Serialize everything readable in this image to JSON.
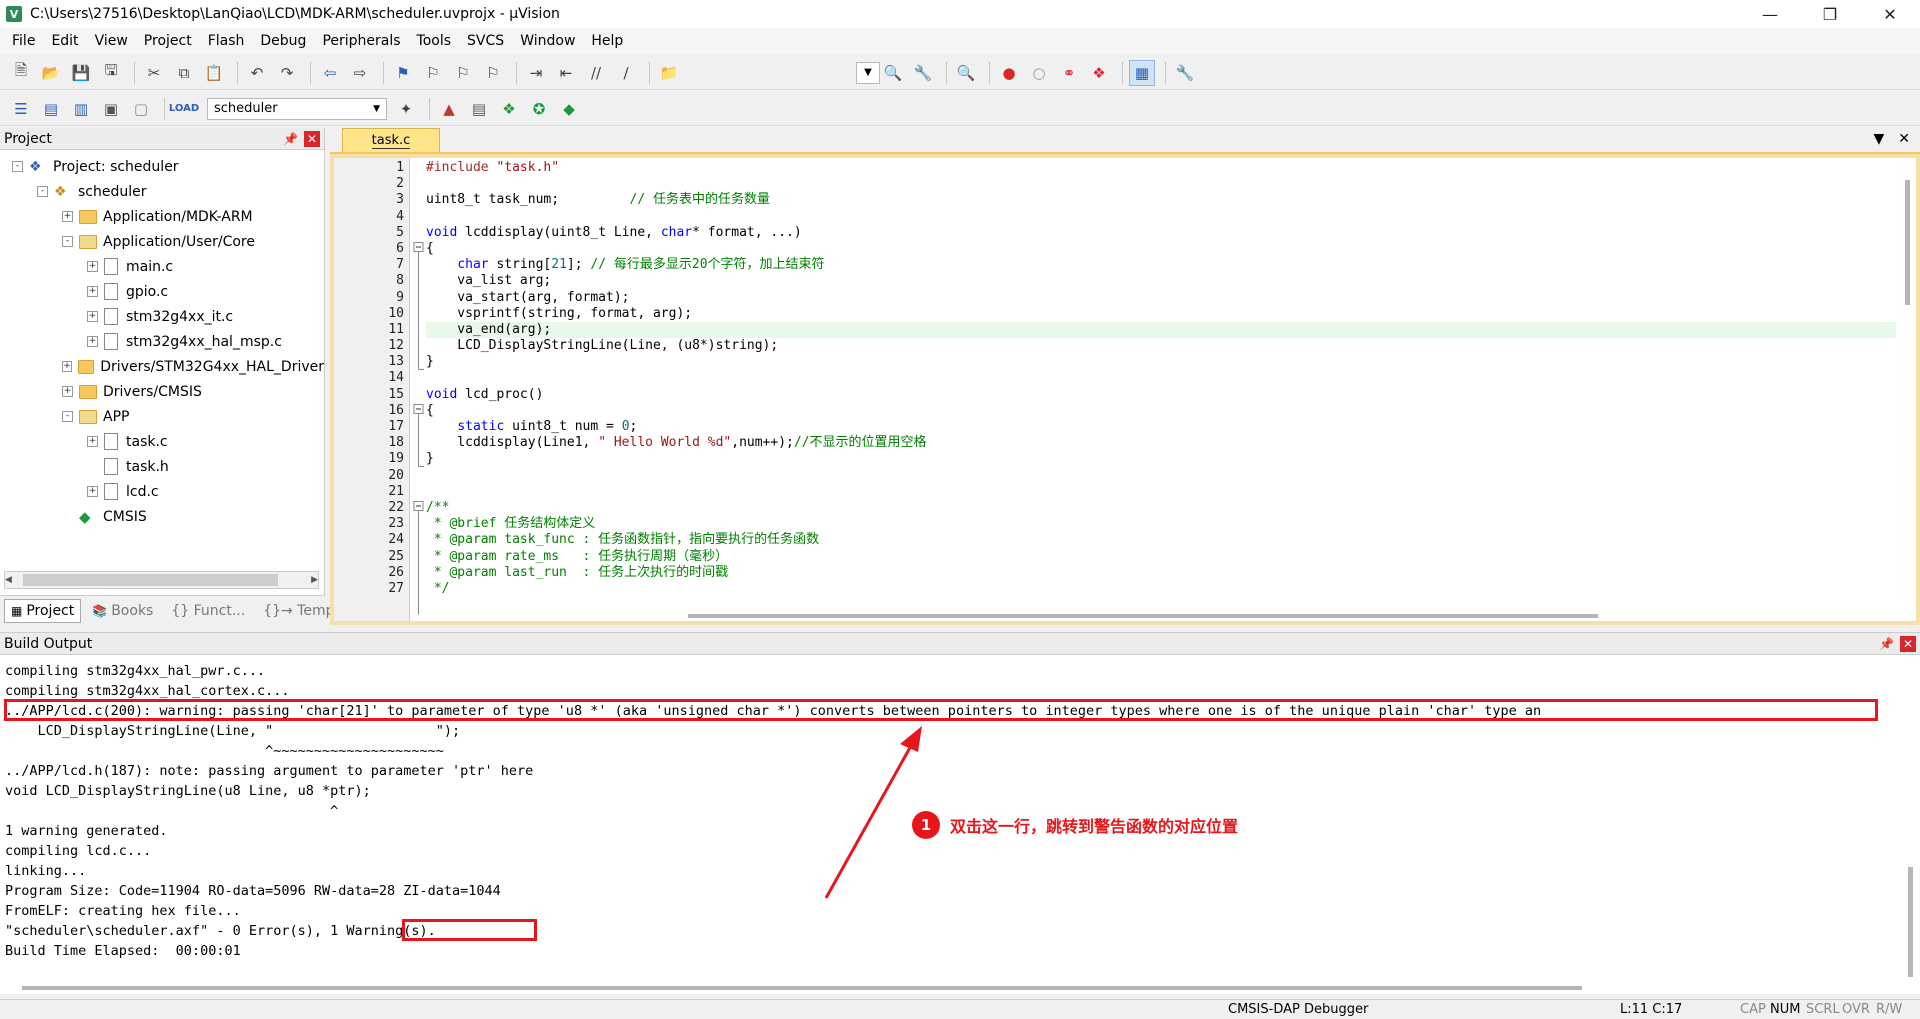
{
  "window": {
    "title": "C:\\Users\\27516\\Desktop\\LanQiao\\LCD\\MDK-ARM\\scheduler.uvprojx - µVision",
    "app_icon_letter": "V"
  },
  "menu": [
    "File",
    "Edit",
    "View",
    "Project",
    "Flash",
    "Debug",
    "Peripherals",
    "Tools",
    "SVCS",
    "Window",
    "Help"
  ],
  "toolbar": {
    "target_name": "scheduler"
  },
  "project_pane": {
    "title": "Project",
    "tree": [
      {
        "label": "Project: scheduler",
        "depth": 0,
        "exp": "-",
        "icon": "project-icon"
      },
      {
        "label": "scheduler",
        "depth": 1,
        "exp": "-",
        "icon": "target-group-icon"
      },
      {
        "label": "Application/MDK-ARM",
        "depth": 2,
        "exp": "+",
        "icon": "folder-icon"
      },
      {
        "label": "Application/User/Core",
        "depth": 2,
        "exp": "-",
        "icon": "folder-open-icon"
      },
      {
        "label": "main.c",
        "depth": 3,
        "exp": "+",
        "icon": "file-icon"
      },
      {
        "label": "gpio.c",
        "depth": 3,
        "exp": "+",
        "icon": "file-icon"
      },
      {
        "label": "stm32g4xx_it.c",
        "depth": 3,
        "exp": "+",
        "icon": "file-icon"
      },
      {
        "label": "stm32g4xx_hal_msp.c",
        "depth": 3,
        "exp": "+",
        "icon": "file-icon"
      },
      {
        "label": "Drivers/STM32G4xx_HAL_Driver",
        "depth": 2,
        "exp": "+",
        "icon": "folder-icon"
      },
      {
        "label": "Drivers/CMSIS",
        "depth": 2,
        "exp": "+",
        "icon": "folder-icon"
      },
      {
        "label": "APP",
        "depth": 2,
        "exp": "-",
        "icon": "folder-open-icon"
      },
      {
        "label": "task.c",
        "depth": 3,
        "exp": "+",
        "icon": "file-icon"
      },
      {
        "label": "task.h",
        "depth": 3,
        "exp": "",
        "icon": "file-icon"
      },
      {
        "label": "lcd.c",
        "depth": 3,
        "exp": "+",
        "icon": "file-icon"
      },
      {
        "label": "CMSIS",
        "depth": 2,
        "exp": "",
        "icon": "cmsis-icon"
      }
    ],
    "tabs": [
      "Project",
      "Books",
      "{} Funct...",
      "{}→ Templ..."
    ]
  },
  "editor": {
    "file_tab": "task.c",
    "highlight_line": 11,
    "lines": [
      {
        "n": "1",
        "html": "<span class=\"pp\">#include</span> <span class=\"st\">\"task.h\"</span>"
      },
      {
        "n": "2",
        "html": ""
      },
      {
        "n": "3",
        "html": "uint8_t task_num;         <span class=\"cm\">// 任务表中的任务数量</span>"
      },
      {
        "n": "4",
        "html": ""
      },
      {
        "n": "5",
        "html": "<span class=\"kw\">void</span> lcddisplay(uint8_t Line, <span class=\"kw\">char</span>* format, ...)"
      },
      {
        "n": "6",
        "html": "{"
      },
      {
        "n": "7",
        "html": "    <span class=\"kw\">char</span> string[<span class=\"num\">21</span>]; <span class=\"cm\">// 每行最多显示20个字符，加上结束符</span>"
      },
      {
        "n": "8",
        "html": "    va_list arg;"
      },
      {
        "n": "9",
        "html": "    va_start(arg, format);"
      },
      {
        "n": "10",
        "html": "    vsprintf(string, format, arg);"
      },
      {
        "n": "11",
        "html": "    va_end(arg);"
      },
      {
        "n": "12",
        "html": "    LCD_DisplayStringLine(Line, (u8*)string);"
      },
      {
        "n": "13",
        "html": "}"
      },
      {
        "n": "14",
        "html": ""
      },
      {
        "n": "15",
        "html": "<span class=\"kw\">void</span> lcd_proc()"
      },
      {
        "n": "16",
        "html": "{"
      },
      {
        "n": "17",
        "html": "    <span class=\"kw\">static</span> uint8_t num = <span class=\"num\">0</span>;"
      },
      {
        "n": "18",
        "html": "    lcddisplay(Line1, <span class=\"st\">\" Hello World %d\"</span>,num++);<span class=\"cm\">//不显示的位置用空格</span>"
      },
      {
        "n": "19",
        "html": "}"
      },
      {
        "n": "20",
        "html": ""
      },
      {
        "n": "21",
        "html": ""
      },
      {
        "n": "22",
        "html": "<span class=\"cm\">/**</span>"
      },
      {
        "n": "23",
        "html": "<span class=\"cm\"> * @brief 任务结构体定义</span>"
      },
      {
        "n": "24",
        "html": "<span class=\"cm\"> * @param task_func : 任务函数指针，指向要执行的任务函数</span>"
      },
      {
        "n": "25",
        "html": "<span class=\"cm\"> * @param rate_ms   : 任务执行周期（毫秒）</span>"
      },
      {
        "n": "26",
        "html": "<span class=\"cm\"> * @param last_run  : 任务上次执行的时间戳</span>"
      },
      {
        "n": "27",
        "html": "<span class=\"cm\"> */</span>"
      }
    ]
  },
  "build_output": {
    "title": "Build Output",
    "lines": [
      "compiling stm32g4xx_hal_pwr.c...",
      "compiling stm32g4xx_hal_cortex.c...",
      "../APP/lcd.c(200): warning: passing 'char[21]' to parameter of type 'u8 *' (aka 'unsigned char *') converts between pointers to integer types where one is of the unique plain 'char' type an",
      "    LCD_DisplayStringLine(Line, \"                    \");",
      "                                ^~~~~~~~~~~~~~~~~~~~~~",
      "../APP/lcd.h(187): note: passing argument to parameter 'ptr' here",
      "void LCD_DisplayStringLine(u8 Line, u8 *ptr);",
      "                                        ^",
      "1 warning generated.",
      "compiling lcd.c...",
      "linking...",
      "Program Size: Code=11904 RO-data=5096 RW-data=28 ZI-data=1044",
      "FromELF: creating hex file...",
      "\"scheduler\\scheduler.axf\" - 0 Error(s), 1 Warning(s).",
      "Build Time Elapsed:  00:00:01"
    ]
  },
  "annotation": {
    "number": "1",
    "text": "双击这一行，跳转到警告函数的对应位置",
    "color": "#e8161c"
  },
  "status": {
    "debugger": "CMSIS-DAP Debugger",
    "position": "L:11 C:17",
    "cap": "CAP",
    "num": "NUM",
    "scrl": "SCRL",
    "ovr": "OVR",
    "rw": "R/W"
  }
}
